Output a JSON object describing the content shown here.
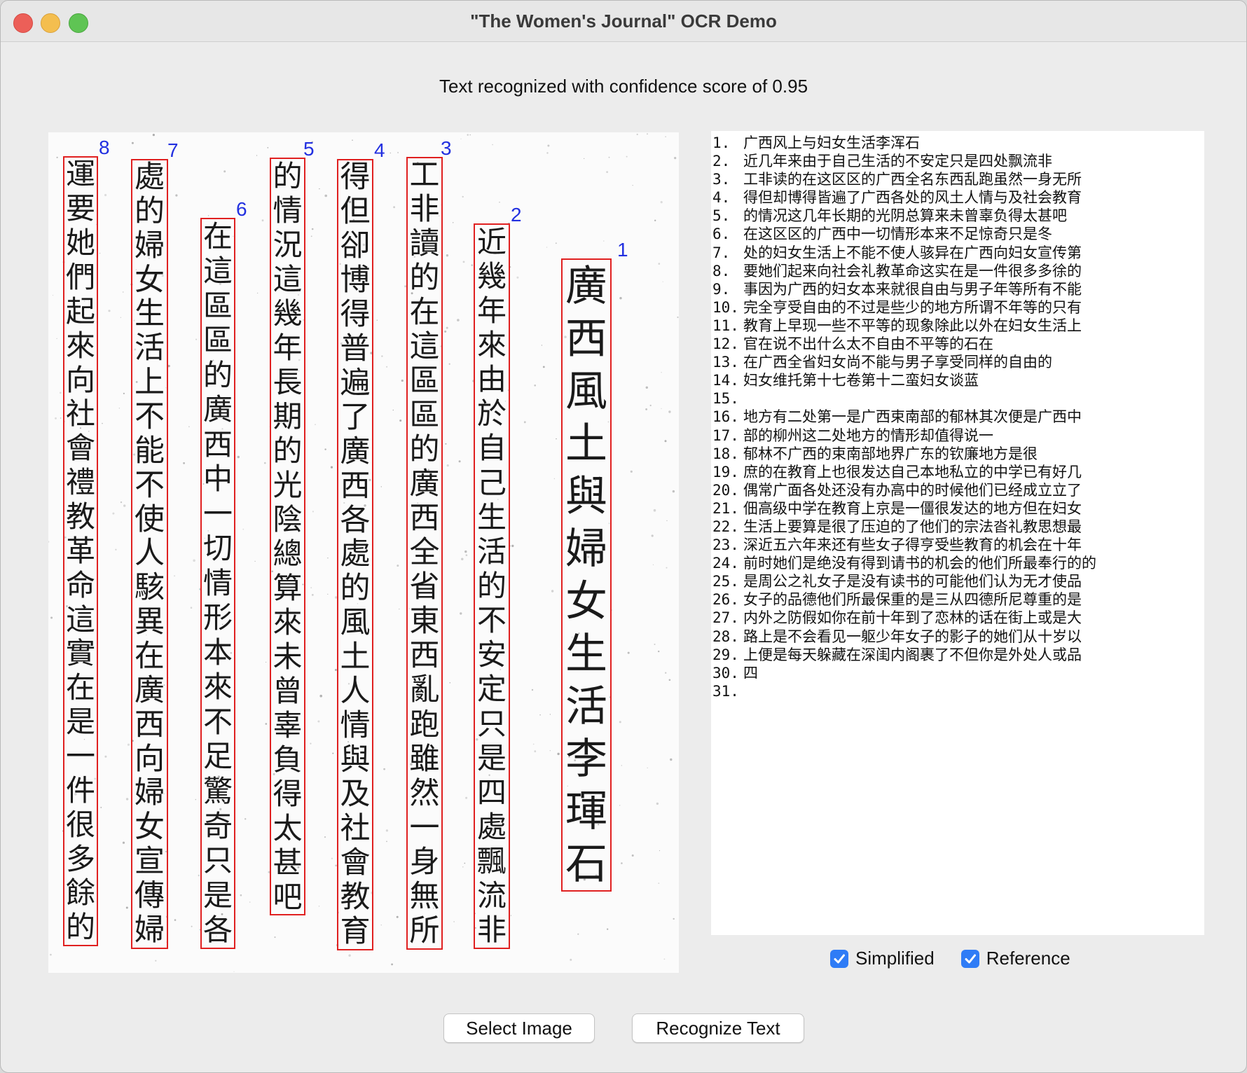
{
  "window": {
    "title": "\"The Women's Journal\" OCR Demo"
  },
  "status": {
    "confidence_text": "Text recognized with confidence score of 0.95"
  },
  "image": {
    "box_color": "#e02020",
    "label_color": "#2230e0",
    "columns": [
      {
        "label": "1",
        "text": "廣西風土與婦女生活李琿石"
      },
      {
        "label": "2",
        "text": "近幾年來由於自己生活的不安定只是四處飄流非"
      },
      {
        "label": "3",
        "text": "工非讀的在這區區的廣西全省東西亂跑雖然一身無所"
      },
      {
        "label": "4",
        "text": "得但卻博得普遍了廣西各處的風土人情與及社會教育"
      },
      {
        "label": "5",
        "text": "的情況這幾年長期的光陰總算來未曾辜負得太甚吧"
      },
      {
        "label": "6",
        "text": "在這區區的廣西中一切情形本來不足驚奇只是各"
      },
      {
        "label": "7",
        "text": "處的婦女生活上不能不使人駭異在廣西向婦女宣傳婦"
      },
      {
        "label": "8",
        "text": "運要她們起來向社會禮教革命這實在是一件很多餘的"
      }
    ]
  },
  "ocr_lines": [
    {
      "n": "1.",
      "text": "广西风上与妇女生活李浑石"
    },
    {
      "n": "2.",
      "text": "近几年来由于自己生活的不安定只是四处飘流非"
    },
    {
      "n": "3.",
      "text": "工非读的在这区区的广西全名东西乱跑虽然一身无所"
    },
    {
      "n": "4.",
      "text": "得但却博得皆遍了广西各处的风土人情与及社会教育"
    },
    {
      "n": "5.",
      "text": "的情况这几年长期的光阴总算来未曾辜负得太甚吧"
    },
    {
      "n": "6.",
      "text": "在这区区的广西中一切情形本来不足惊奇只是冬"
    },
    {
      "n": "7.",
      "text": "处的妇女生活上不能不使人骇异在广西向妇女宣传第"
    },
    {
      "n": "8.",
      "text": "要她们起来向社会礼教革命这实在是一件很多多徐的"
    },
    {
      "n": "9.",
      "text": "事因为广西的妇女本来就很自由与男子年等所有不能"
    },
    {
      "n": "10.",
      "text": "完全亨受自由的不过是些少的地方所谓不年等的只有"
    },
    {
      "n": "11.",
      "text": "教育上早现一些不平等的现象除此以外在妇女生活上"
    },
    {
      "n": "12.",
      "text": "官在说不出什么太不自由不平等的石在"
    },
    {
      "n": "13.",
      "text": "在广西全省妇女尚不能与男子享受同样的自由的"
    },
    {
      "n": "14.",
      "text": "妇女维托第十七卷第十二蛮妇女谈蓝"
    },
    {
      "n": "15.",
      "text": ""
    },
    {
      "n": "16.",
      "text": "地方有二处第一是广西束南部的郁林其次便是广西中"
    },
    {
      "n": "17.",
      "text": "部的柳州这二处地方的情形却值得说一"
    },
    {
      "n": "18.",
      "text": "郁林不广西的束南部地界广东的钦廉地方是很"
    },
    {
      "n": "19.",
      "text": "庶的在教育上也很发达自己本地私立的中学已有好几"
    },
    {
      "n": "20.",
      "text": "偶常广面各处还没有办高中的时候他们已经成立立了"
    },
    {
      "n": "21.",
      "text": "佃高级中学在教育上京是一僵很发达的地方但在妇女"
    },
    {
      "n": "22.",
      "text": "生活上要算是很了压迫的了他们的宗法沓礼教思想最"
    },
    {
      "n": "23.",
      "text": "深近五六年来还有些女子得亨受些教育的机会在十年"
    },
    {
      "n": "24.",
      "text": "前时她们是绝没有得到请书的机会的他们所最奉行的的"
    },
    {
      "n": "25.",
      "text": "是周公之礼女子是没有读书的可能他们认为无才使品"
    },
    {
      "n": "26.",
      "text": "女子的品德他们所最保重的是三从四德所尼尊重的是"
    },
    {
      "n": "27.",
      "text": "内外之防假如你在前十年到了恋林的话在街上或是大"
    },
    {
      "n": "28.",
      "text": "路上是不会看见一躯少年女子的影子的她们从十岁以"
    },
    {
      "n": "29.",
      "text": "上便是每天躲藏在深闺内阁裹了不但你是外处人或品"
    },
    {
      "n": "30.",
      "text": "四"
    },
    {
      "n": "31.",
      "text": ""
    }
  ],
  "options": {
    "simplified_label": "Simplified",
    "reference_label": "Reference",
    "simplified_checked": true,
    "reference_checked": true,
    "check_color": "#2f7cf6"
  },
  "buttons": {
    "select_label": "Select Image",
    "recognize_label": "Recognize Text"
  }
}
